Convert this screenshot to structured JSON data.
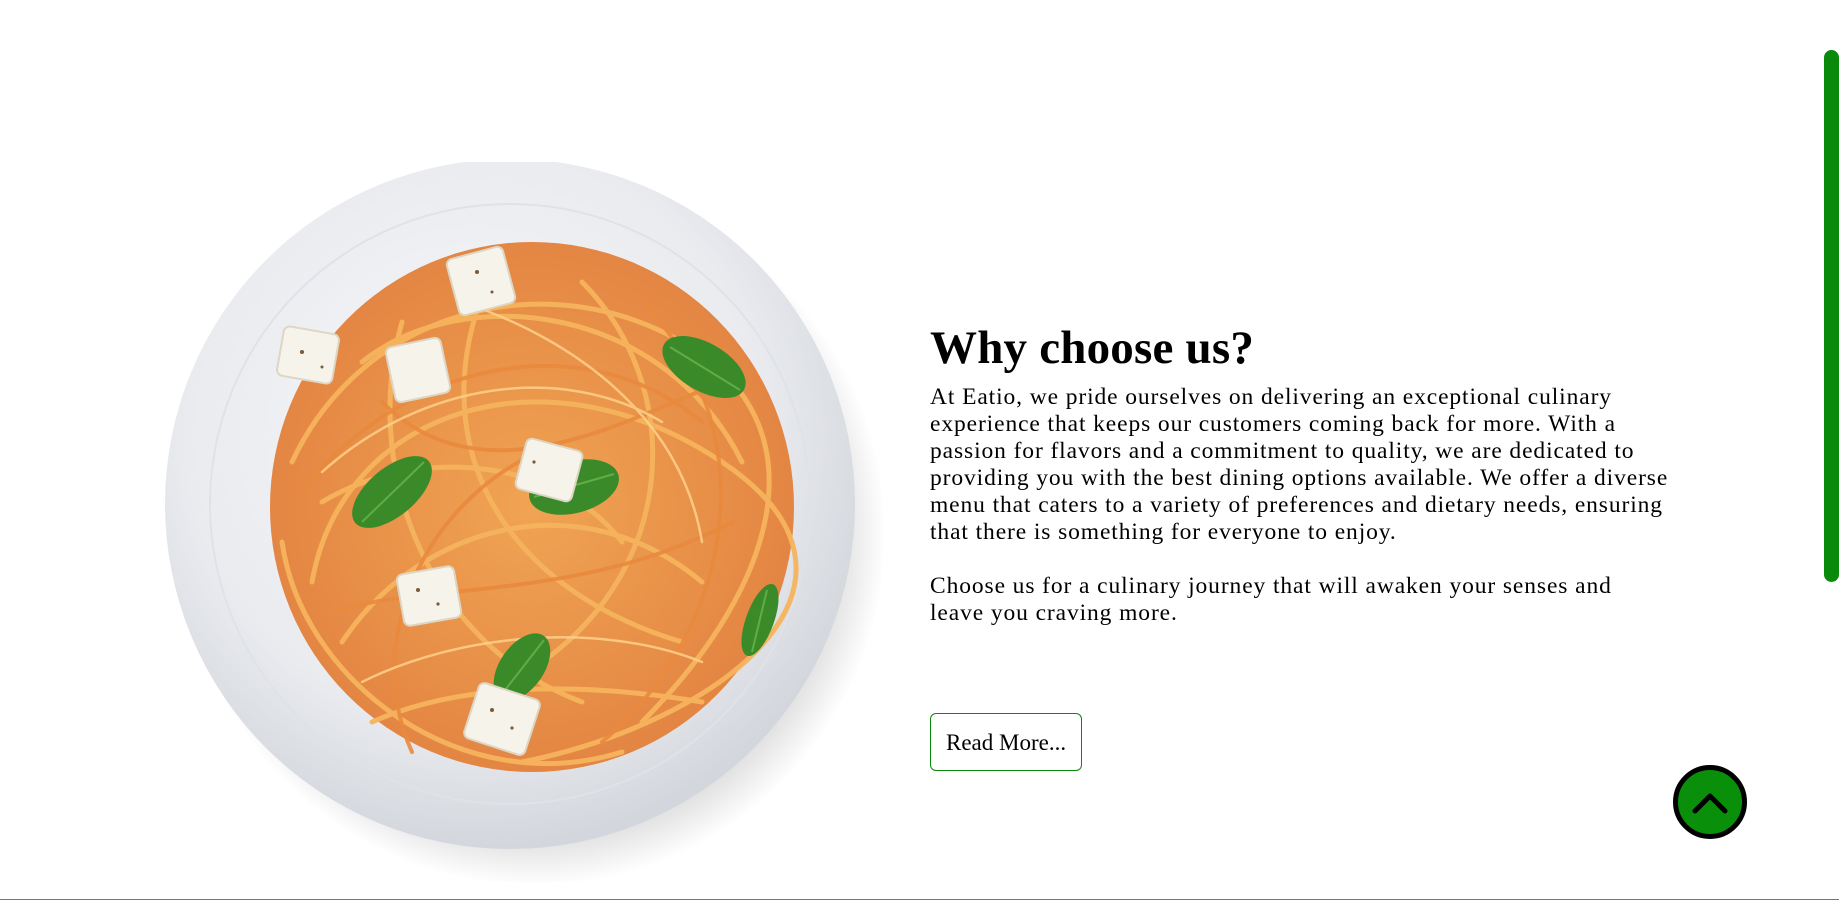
{
  "section": {
    "title": "Why choose us?",
    "paragraphs": [
      "At Eatio, we pride ourselves on delivering an exceptional culinary experience that keeps our customers coming back for more. With a passion for flavors and a commitment to quality, we are dedicated to providing you with the best dining options available. We offer a diverse menu that caters to a variety of preferences and dietary needs, ensuring that there is something for everyone to enjoy.",
      "Choose us for a culinary journey that will awaken your senses and leave you craving more."
    ],
    "button_label": "Read More..."
  },
  "image": {
    "subject": "spaghetti-plate-with-feta-and-basil"
  },
  "icons": {
    "scroll_top": "chevron-up-icon"
  },
  "colors": {
    "accent": "#0a8a0a",
    "text": "#000000",
    "background": "#ffffff"
  }
}
